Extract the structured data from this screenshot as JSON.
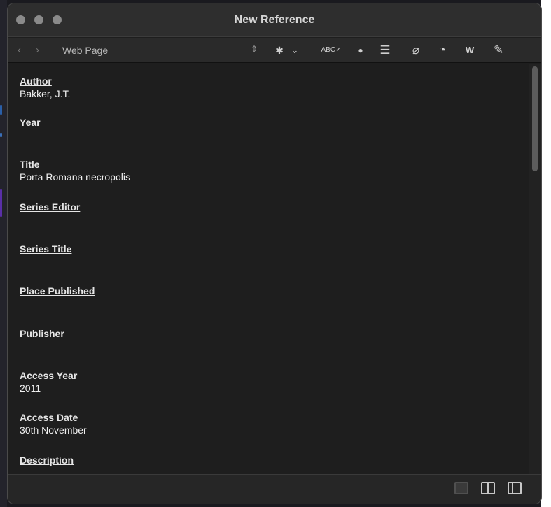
{
  "window": {
    "title": "New Reference"
  },
  "toolbar": {
    "back_icon": "‹",
    "forward_icon": "›",
    "reference_type": "Web Page",
    "updown_icon": "⇕",
    "icons": [
      {
        "name": "gear-icon",
        "glyph": "✱"
      },
      {
        "name": "chevron-down-icon",
        "glyph": "⌄"
      },
      {
        "name": "spellcheck-icon",
        "glyph": "ABC✓"
      },
      {
        "name": "color-dots-icon",
        "glyph": "●"
      },
      {
        "name": "insert-field-icon",
        "glyph": "☰"
      },
      {
        "name": "attachment-icon",
        "glyph": "⌀"
      },
      {
        "name": "pie-chart-icon",
        "glyph": "◔"
      },
      {
        "name": "word-icon",
        "glyph": "W"
      },
      {
        "name": "edit-note-icon",
        "glyph": "✎"
      }
    ]
  },
  "fields": [
    {
      "label": "Author",
      "value": "Bakker, J.T."
    },
    {
      "label": "Year",
      "value": ""
    },
    {
      "label": "Title",
      "value": "Porta Romana necropolis"
    },
    {
      "label": "Series Editor",
      "value": ""
    },
    {
      "label": "Series Title",
      "value": ""
    },
    {
      "label": "Place Published",
      "value": ""
    },
    {
      "label": "Publisher",
      "value": ""
    },
    {
      "label": "Access Year",
      "value": "2011"
    },
    {
      "label": "Access Date",
      "value": "30th November"
    },
    {
      "label": "Description",
      "value": ""
    }
  ],
  "layout_buttons": [
    "layout-left-pane",
    "layout-split-pane",
    "layout-right-pane"
  ]
}
